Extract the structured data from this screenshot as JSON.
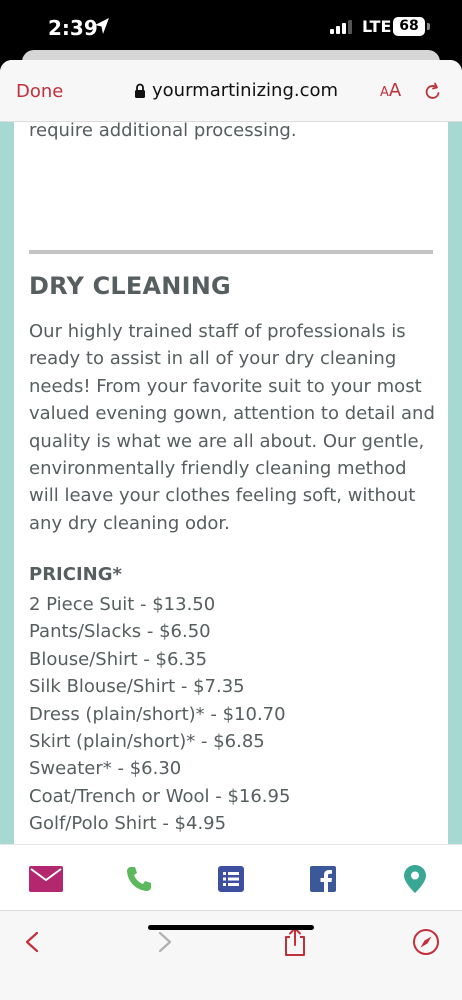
{
  "status_bar": {
    "time": "2:39",
    "network": "LTE",
    "battery": "68"
  },
  "browser": {
    "done_label": "Done",
    "url": "yourmartinizing.com",
    "aa_label_small": "A",
    "aa_label_large": "A"
  },
  "page": {
    "prev_text": "require additional processing.",
    "section_title": "DRY CLEANING",
    "body": "Our highly trained staff of professionals is ready to assist in all of your dry cleaning needs! From your favorite suit to your most valued evening gown, attention to detail and quality is what we are all about. Our gentle, environmentally friendly cleaning method will leave your clothes feeling soft, without any dry cleaning odor.",
    "pricing_title": "PRICING*",
    "prices": [
      "2 Piece Suit - $13.50",
      "Pants/Slacks - $6.50",
      "Blouse/Shirt - $6.35",
      "Silk Blouse/Shirt - $7.35",
      "Dress (plain/short)* - $10.70",
      "Skirt (plain/short)* - $6.85",
      "Sweater* - $6.30",
      "Coat/Trench or Wool - $16.95",
      "Golf/Polo Shirt - $4.95"
    ]
  },
  "footer_icons": [
    "mail-icon",
    "phone-icon",
    "list-icon",
    "facebook-icon",
    "map-pin-icon"
  ],
  "toolbar_icons": [
    "back-icon",
    "forward-icon",
    "share-icon",
    "compass-icon"
  ],
  "colors": {
    "accent_red": "#c1313c",
    "teal_bg": "#a8d8d2",
    "text_gray": "#565e5f",
    "mail": "#b3276f",
    "phone": "#5cb85c",
    "list": "#3f4fa0",
    "facebook": "#3b5998",
    "map": "#3aa795"
  }
}
